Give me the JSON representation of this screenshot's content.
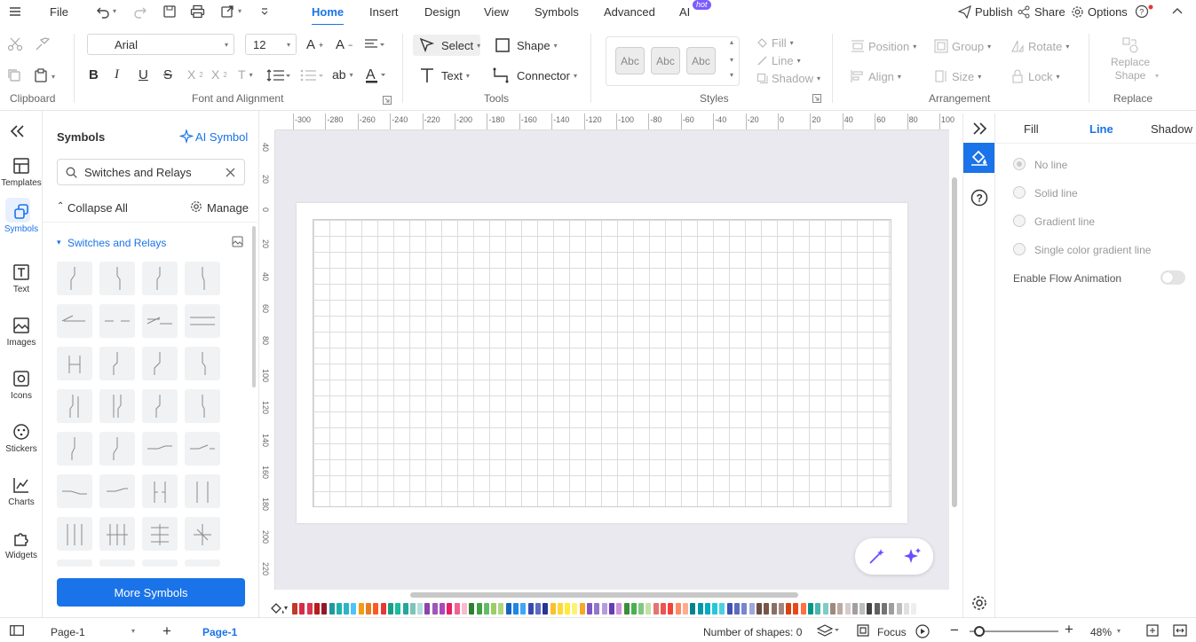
{
  "menu": {
    "file": "File"
  },
  "tabs": [
    {
      "label": "Home",
      "active": true
    },
    {
      "label": "Insert"
    },
    {
      "label": "Design"
    },
    {
      "label": "View"
    },
    {
      "label": "Symbols"
    },
    {
      "label": "Advanced"
    },
    {
      "label": "AI",
      "badge": "hot"
    }
  ],
  "top_actions": {
    "publish": "Publish",
    "share": "Share",
    "options": "Options"
  },
  "ribbon": {
    "clipboard": "Clipboard",
    "font_alignment": "Font and Alignment",
    "font_name": "Arial",
    "font_size": "12",
    "tools": "Tools",
    "select": "Select",
    "shape": "Shape",
    "text": "Text",
    "connector": "Connector",
    "styles": "Styles",
    "style_samples": [
      "Abc",
      "Abc",
      "Abc"
    ],
    "fill": "Fill",
    "line": "Line",
    "shadow": "Shadow",
    "position": "Position",
    "group": "Group",
    "rotate": "Rotate",
    "align": "Align",
    "size": "Size",
    "lock": "Lock",
    "arrangement": "Arrangement",
    "replace_shape": "Replace Shape",
    "replace": "Replace"
  },
  "rail": [
    {
      "label": "Templates",
      "icon": "templates-icon"
    },
    {
      "label": "Symbols",
      "icon": "symbols-icon",
      "active": true
    },
    {
      "label": "Text",
      "icon": "text-icon"
    },
    {
      "label": "Images",
      "icon": "images-icon"
    },
    {
      "label": "Icons",
      "icon": "icons-icon"
    },
    {
      "label": "Stickers",
      "icon": "stickers-icon"
    },
    {
      "label": "Charts",
      "icon": "charts-icon"
    },
    {
      "label": "Widgets",
      "icon": "widgets-icon"
    }
  ],
  "symbols_panel": {
    "title": "Symbols",
    "ai_symbol": "AI Symbol",
    "search_value": "Switches and Relays",
    "collapse_all": "Collapse All",
    "manage": "Manage",
    "category": "Switches and Relays",
    "more_symbols": "More Symbols"
  },
  "ruler": {
    "h_ticks": [
      "-300",
      "-280",
      "-260",
      "-240",
      "-220",
      "-200",
      "-180",
      "-160",
      "-140",
      "-120",
      "-100",
      "-80",
      "-60",
      "-40",
      "-20",
      "0",
      "20",
      "40",
      "60",
      "80",
      "100"
    ],
    "v_ticks": [
      "40",
      "20",
      "0",
      "20",
      "40",
      "60",
      "80",
      "100",
      "120",
      "140",
      "160",
      "180",
      "200",
      "220"
    ]
  },
  "properties": {
    "tabs": [
      "Fill",
      "Line",
      "Shadow"
    ],
    "active_tab": "Line",
    "options": [
      "No line",
      "Solid line",
      "Gradient line",
      "Single color gradient line"
    ],
    "flow_animation": "Enable Flow Animation"
  },
  "status": {
    "page_select": "Page-1",
    "page_tab": "Page-1",
    "shapes": "Number of shapes: 0",
    "focus": "Focus",
    "zoom": "48%"
  },
  "colors": {
    "accent": "#1a73e8",
    "palette": [
      "#c0392b",
      "#d62c4a",
      "#e0334f",
      "#b71c1c",
      "#8e1b2c",
      "#1b9aa0",
      "#20b2aa",
      "#2bb5c7",
      "#4fc3f7",
      "#f39c12",
      "#e67e22",
      "#ff5722",
      "#e53935",
      "#16a085",
      "#1abc9c",
      "#26a69a",
      "#7cc5b9",
      "#b2dfdb",
      "#8e44ad",
      "#9b59b6",
      "#ab47bc",
      "#e91e63",
      "#f06292",
      "#f8bbd0",
      "#2e7d32",
      "#43a047",
      "#66bb6a",
      "#9ccc65",
      "#aed581",
      "#1565c0",
      "#1e88e5",
      "#42a5f5",
      "#3949ab",
      "#5c6bc0",
      "#283593",
      "#fbc02d",
      "#fdd835",
      "#ffeb3b",
      "#fff176",
      "#f9a825",
      "#7e57c2",
      "#9575cd",
      "#b39ddb",
      "#673ab7",
      "#ce93d8",
      "#388e3c",
      "#4caf50",
      "#81c784",
      "#c5e1a5",
      "#e57373",
      "#ef5350",
      "#f44336",
      "#ff8a65",
      "#ffab91",
      "#00838f",
      "#0097a7",
      "#00acc1",
      "#26c6da",
      "#4dd0e1",
      "#3f51b5",
      "#5c6bc0",
      "#7986cb",
      "#9fa8da",
      "#6d4c41",
      "#795548",
      "#8d6e63",
      "#a1887f",
      "#d84315",
      "#e64a19",
      "#ff7043",
      "#009688",
      "#4db6ac",
      "#80cbc4",
      "#a1887f",
      "#bcaaa4",
      "#d7ccc8",
      "#a0a0a0",
      "#bdbdbd",
      "#424242",
      "#616161",
      "#757575",
      "#9e9e9e",
      "#bdbdbd",
      "#e0e0e0",
      "#eeeeee"
    ]
  }
}
